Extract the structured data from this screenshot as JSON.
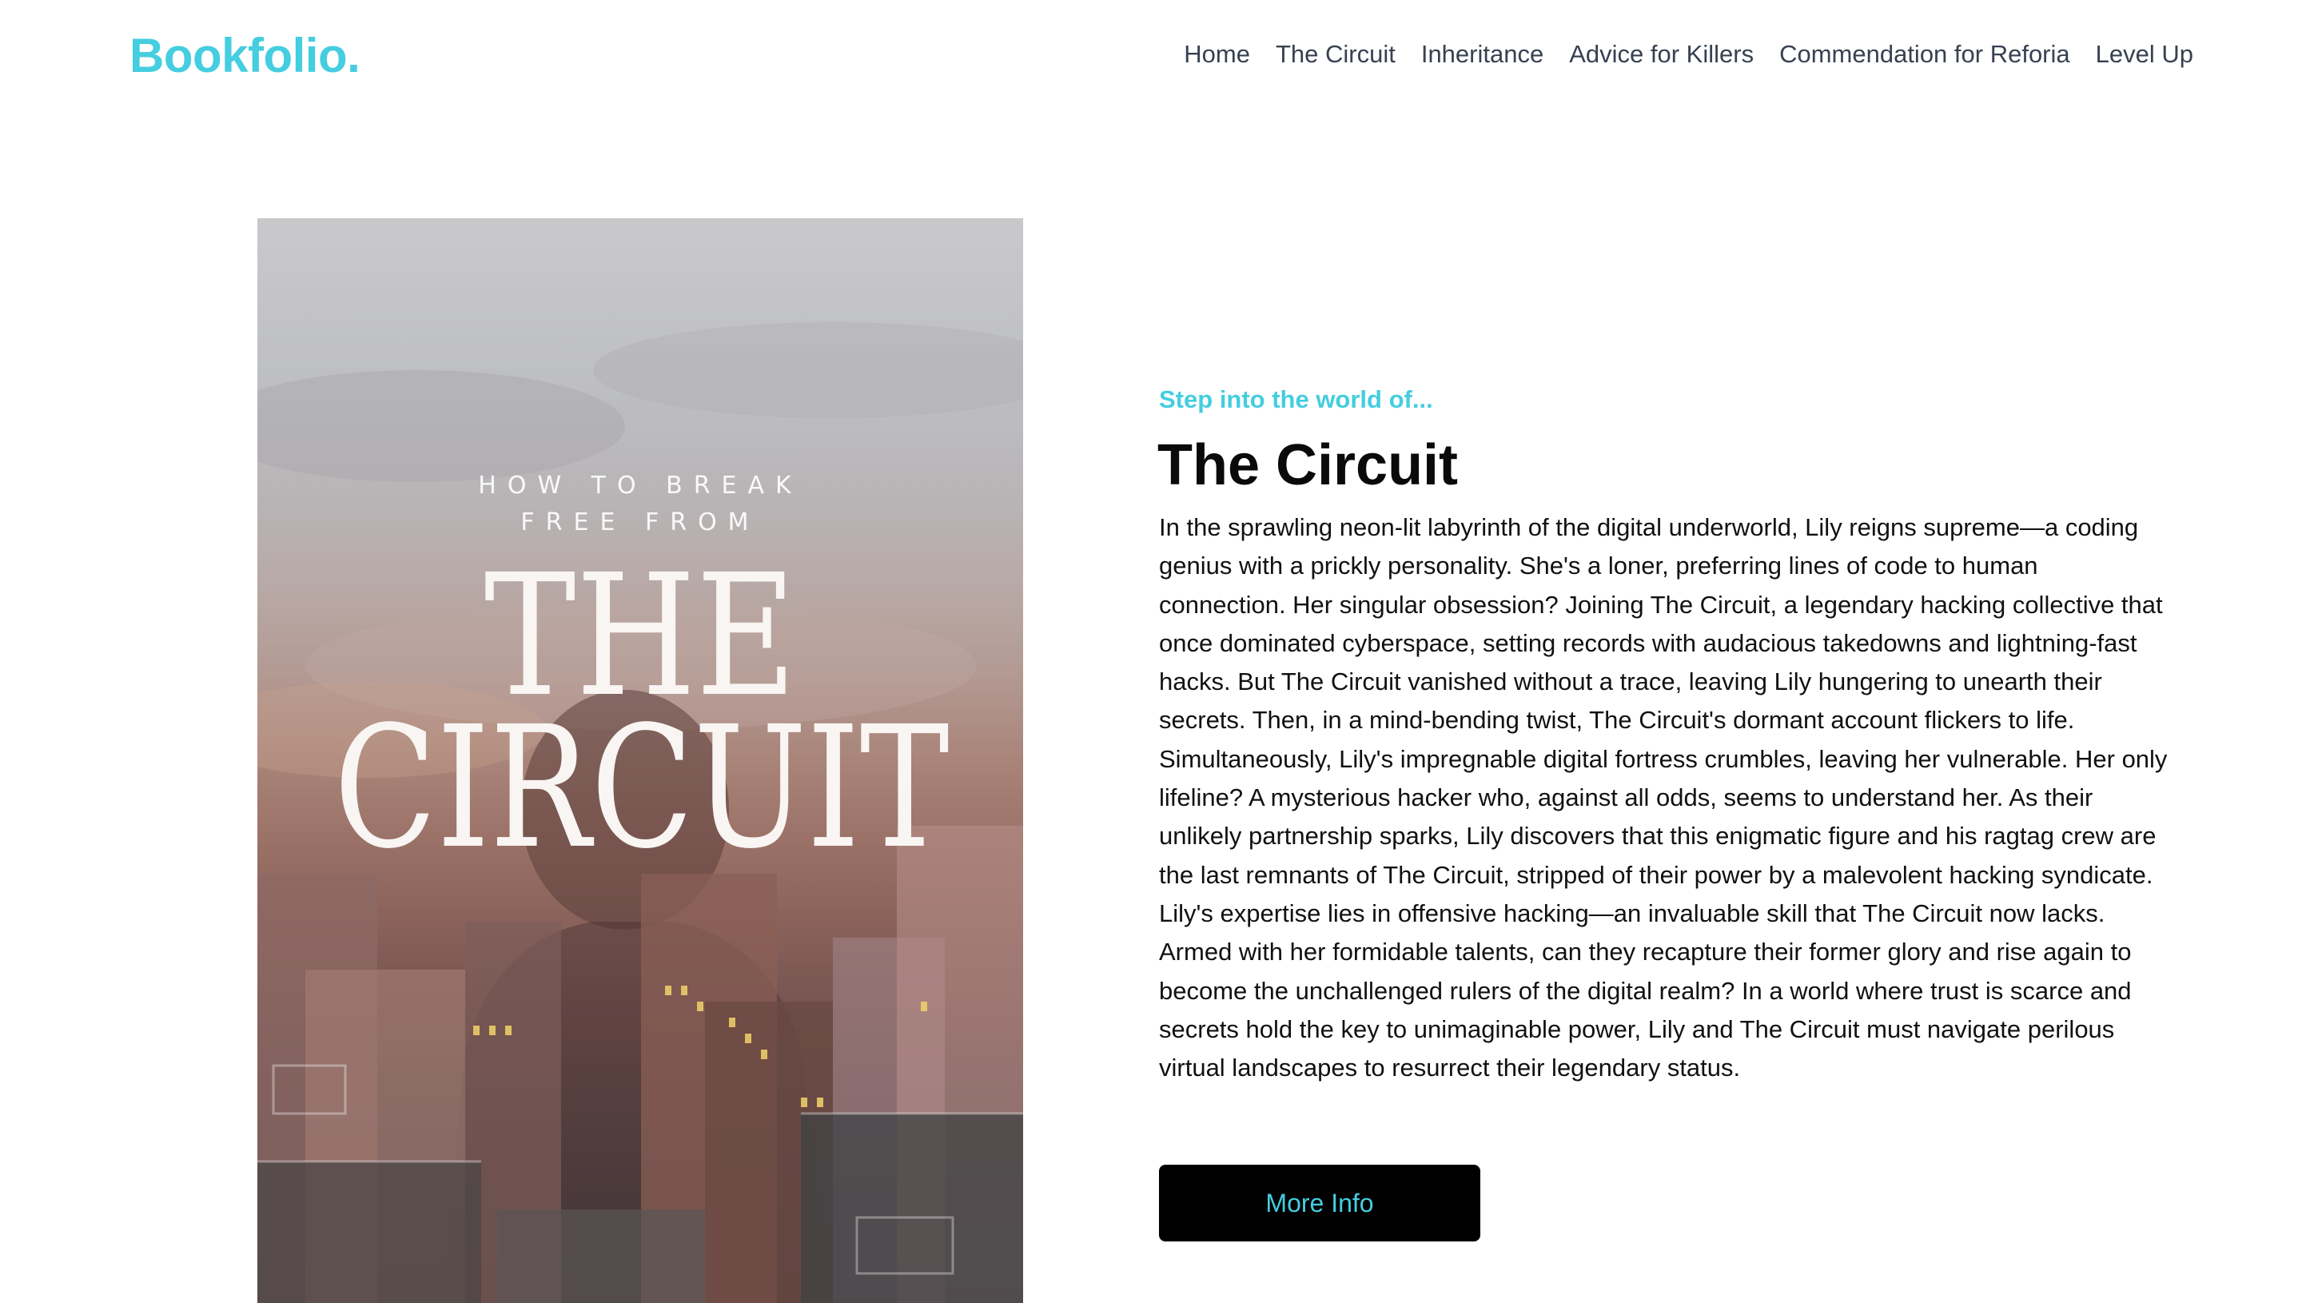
{
  "header": {
    "logo": "Bookfolio.",
    "nav": [
      {
        "label": "Home"
      },
      {
        "label": "The Circuit"
      },
      {
        "label": "Inheritance"
      },
      {
        "label": "Advice for Killers"
      },
      {
        "label": "Commendation for Reforia"
      },
      {
        "label": "Level Up"
      }
    ]
  },
  "cover": {
    "tagline_line1": "HOW TO BREAK",
    "tagline_line2": "FREE FROM",
    "title_line1": "THE",
    "title_line2": "CIRCUIT"
  },
  "hero": {
    "eyebrow": "Step into the world of...",
    "title": "The Circuit",
    "description": "In the sprawling neon-lit labyrinth of the digital underworld, Lily reigns supreme—a coding genius with a prickly personality. She's a loner, preferring lines of code to human connection. Her singular obsession? Joining The Circuit, a legendary hacking collective that once dominated cyberspace, setting records with audacious takedowns and lightning-fast hacks. But The Circuit vanished without a trace, leaving Lily hungering to unearth their secrets. Then, in a mind-bending twist, The Circuit's dormant account flickers to life. Simultaneously, Lily's impregnable digital fortress crumbles, leaving her vulnerable. Her only lifeline? A mysterious hacker who, against all odds, seems to understand her. As their unlikely partnership sparks, Lily discovers that this enigmatic figure and his ragtag crew are the last remnants of The Circuit, stripped of their power by a malevolent hacking syndicate. Lily's expertise lies in offensive hacking—an invaluable skill that The Circuit now lacks. Armed with her formidable talents, can they recapture their former glory and rise again to become the unchallenged rulers of the digital realm? In a world where trust is scarce and secrets hold the key to unimaginable power, Lily and The Circuit must navigate perilous virtual landscapes to resurrect their legendary status.",
    "button_label": "More Info"
  },
  "colors": {
    "accent": "#45cde0",
    "button_bg": "#000000",
    "nav_text": "#374151"
  }
}
